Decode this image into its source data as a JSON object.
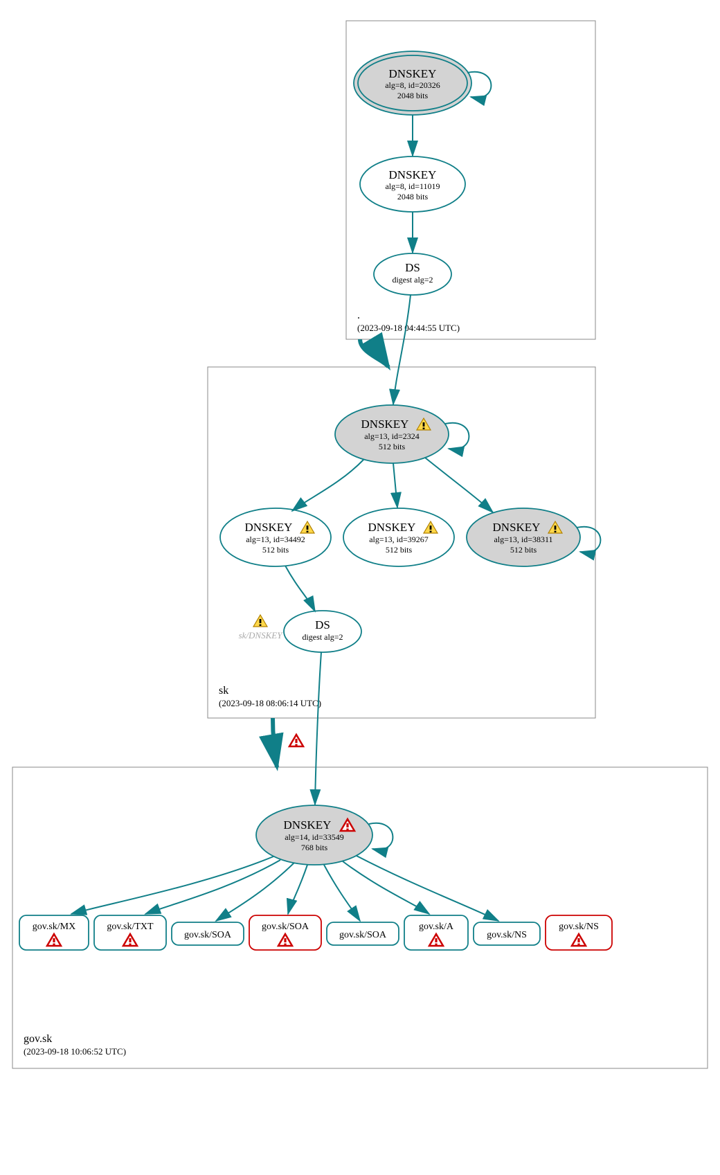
{
  "zones": {
    "root": {
      "label": ".",
      "time": "(2023-09-18 04:44:55 UTC)"
    },
    "sk": {
      "label": "sk",
      "time": "(2023-09-18 08:06:14 UTC)"
    },
    "gov": {
      "label": "gov.sk",
      "time": "(2023-09-18 10:06:52 UTC)"
    }
  },
  "nodes": {
    "root_ksk": {
      "title": "DNSKEY",
      "l1": "alg=8, id=20326",
      "l2": "2048 bits"
    },
    "root_zsk": {
      "title": "DNSKEY",
      "l1": "alg=8, id=11019",
      "l2": "2048 bits"
    },
    "root_ds": {
      "title": "DS",
      "l1": "digest alg=2"
    },
    "sk_ksk": {
      "title": "DNSKEY",
      "l1": "alg=13, id=2324",
      "l2": "512 bits"
    },
    "sk_z1": {
      "title": "DNSKEY",
      "l1": "alg=13, id=34492",
      "l2": "512 bits"
    },
    "sk_z2": {
      "title": "DNSKEY",
      "l1": "alg=13, id=39267",
      "l2": "512 bits"
    },
    "sk_z3": {
      "title": "DNSKEY",
      "l1": "alg=13, id=38311",
      "l2": "512 bits"
    },
    "sk_ds": {
      "title": "DS",
      "l1": "digest alg=2"
    },
    "sk_extra": {
      "label": "sk/DNSKEY"
    },
    "gov_ksk": {
      "title": "DNSKEY",
      "l1": "alg=14, id=33549",
      "l2": "768 bits"
    },
    "rr_mx": {
      "label": "gov.sk/MX"
    },
    "rr_txt": {
      "label": "gov.sk/TXT"
    },
    "rr_soa1": {
      "label": "gov.sk/SOA"
    },
    "rr_soa2": {
      "label": "gov.sk/SOA"
    },
    "rr_soa3": {
      "label": "gov.sk/SOA"
    },
    "rr_a": {
      "label": "gov.sk/A"
    },
    "rr_ns1": {
      "label": "gov.sk/NS"
    },
    "rr_ns2": {
      "label": "gov.sk/NS"
    }
  },
  "chart_data": {
    "type": "dnssec-delegation-graph",
    "zones": [
      {
        "name": ".",
        "timestamp": "2023-09-18 04:44:55 UTC",
        "nodes": [
          {
            "id": "root_ksk",
            "type": "DNSKEY",
            "alg": 8,
            "key_id": 20326,
            "bits": 2048,
            "ksk": true,
            "trust_anchor": true,
            "self_sign": true
          },
          {
            "id": "root_zsk",
            "type": "DNSKEY",
            "alg": 8,
            "key_id": 11019,
            "bits": 2048
          },
          {
            "id": "root_ds",
            "type": "DS",
            "digest_alg": 2
          }
        ],
        "edges": [
          {
            "from": "root_ksk",
            "to": "root_zsk"
          },
          {
            "from": "root_zsk",
            "to": "root_ds"
          }
        ]
      },
      {
        "name": "sk",
        "timestamp": "2023-09-18 08:06:14 UTC",
        "nodes": [
          {
            "id": "sk_ksk",
            "type": "DNSKEY",
            "alg": 13,
            "key_id": 2324,
            "bits": 512,
            "ksk": true,
            "self_sign": true,
            "status": "warning"
          },
          {
            "id": "sk_z1",
            "type": "DNSKEY",
            "alg": 13,
            "key_id": 34492,
            "bits": 512,
            "status": "warning"
          },
          {
            "id": "sk_z2",
            "type": "DNSKEY",
            "alg": 13,
            "key_id": 39267,
            "bits": 512,
            "status": "warning"
          },
          {
            "id": "sk_z3",
            "type": "DNSKEY",
            "alg": 13,
            "key_id": 38311,
            "bits": 512,
            "ksk": true,
            "self_sign": true,
            "status": "warning"
          },
          {
            "id": "sk_ds",
            "type": "DS",
            "digest_alg": 2
          },
          {
            "id": "sk_extra",
            "type": "placeholder",
            "label": "sk/DNSKEY",
            "status": "warning"
          }
        ],
        "edges": [
          {
            "from": "root_ds",
            "to": "sk_ksk"
          },
          {
            "from": "sk_ksk",
            "to": "sk_z1"
          },
          {
            "from": "sk_ksk",
            "to": "sk_z2"
          },
          {
            "from": "sk_ksk",
            "to": "sk_z3"
          },
          {
            "from": "sk_z1",
            "to": "sk_ds"
          }
        ],
        "delegation_edge": {
          "from_zone": ".",
          "to_zone": "sk",
          "thick": true
        }
      },
      {
        "name": "gov.sk",
        "timestamp": "2023-09-18 10:06:52 UTC",
        "nodes": [
          {
            "id": "gov_ksk",
            "type": "DNSKEY",
            "alg": 14,
            "key_id": 33549,
            "bits": 768,
            "ksk": true,
            "self_sign": true,
            "status": "error"
          },
          {
            "id": "rr_mx",
            "type": "RRset",
            "label": "gov.sk/MX",
            "status": "error"
          },
          {
            "id": "rr_txt",
            "type": "RRset",
            "label": "gov.sk/TXT",
            "status": "error"
          },
          {
            "id": "rr_soa1",
            "type": "RRset",
            "label": "gov.sk/SOA"
          },
          {
            "id": "rr_soa2",
            "type": "RRset",
            "label": "gov.sk/SOA",
            "status": "error",
            "border": "red"
          },
          {
            "id": "rr_soa3",
            "type": "RRset",
            "label": "gov.sk/SOA"
          },
          {
            "id": "rr_a",
            "type": "RRset",
            "label": "gov.sk/A",
            "status": "error"
          },
          {
            "id": "rr_ns1",
            "type": "RRset",
            "label": "gov.sk/NS"
          },
          {
            "id": "rr_ns2",
            "type": "RRset",
            "label": "gov.sk/NS",
            "status": "error",
            "border": "red"
          }
        ],
        "edges": [
          {
            "from": "sk_ds",
            "to": "gov_ksk"
          },
          {
            "from": "gov_ksk",
            "to": "rr_mx"
          },
          {
            "from": "gov_ksk",
            "to": "rr_txt"
          },
          {
            "from": "gov_ksk",
            "to": "rr_soa1"
          },
          {
            "from": "gov_ksk",
            "to": "rr_soa2"
          },
          {
            "from": "gov_ksk",
            "to": "rr_soa3"
          },
          {
            "from": "gov_ksk",
            "to": "rr_a"
          },
          {
            "from": "gov_ksk",
            "to": "rr_ns1"
          }
        ],
        "delegation_edge": {
          "from_zone": "sk",
          "to_zone": "gov.sk",
          "thick": true,
          "status": "error"
        }
      }
    ]
  }
}
